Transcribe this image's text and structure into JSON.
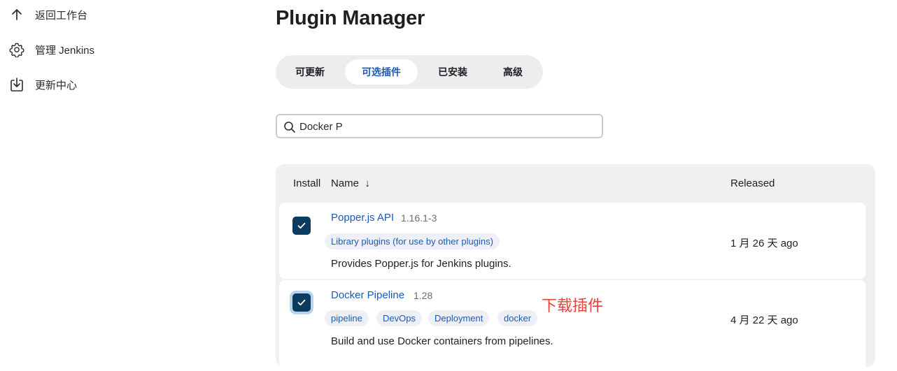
{
  "sidebar": {
    "items": [
      {
        "label": "返回工作台",
        "icon": "arrow-up-icon"
      },
      {
        "label": "管理 Jenkins",
        "icon": "gear-icon"
      },
      {
        "label": "更新中心",
        "icon": "download-icon"
      }
    ]
  },
  "page": {
    "title": "Plugin Manager"
  },
  "tabs": [
    {
      "label": "可更新",
      "active": false
    },
    {
      "label": "可选插件",
      "active": true
    },
    {
      "label": "已安装",
      "active": false
    },
    {
      "label": "高级",
      "active": false
    }
  ],
  "search": {
    "value": "Docker P",
    "icon": "search-icon"
  },
  "table": {
    "headers": {
      "install": "Install",
      "name": "Name",
      "sort_indicator": "↓",
      "released": "Released"
    },
    "rows": [
      {
        "checked": true,
        "name": "Popper.js API",
        "version": "1.16.1-3",
        "tags": [
          "Library plugins (for use by other plugins)"
        ],
        "description": "Provides Popper.js for Jenkins plugins.",
        "released": "1 月 26 天 ago"
      },
      {
        "checked": true,
        "name": "Docker Pipeline",
        "version": "1.28",
        "tags": [
          "pipeline",
          "DevOps",
          "Deployment",
          "docker"
        ],
        "description": "Build and use Docker containers from pipelines.",
        "released": "4 月 22 天 ago"
      }
    ]
  },
  "annotation": {
    "text": "下载插件",
    "color": "#e8413a"
  },
  "colors": {
    "accent": "#1a5ab8",
    "checkbox": "#0b3b5e"
  }
}
